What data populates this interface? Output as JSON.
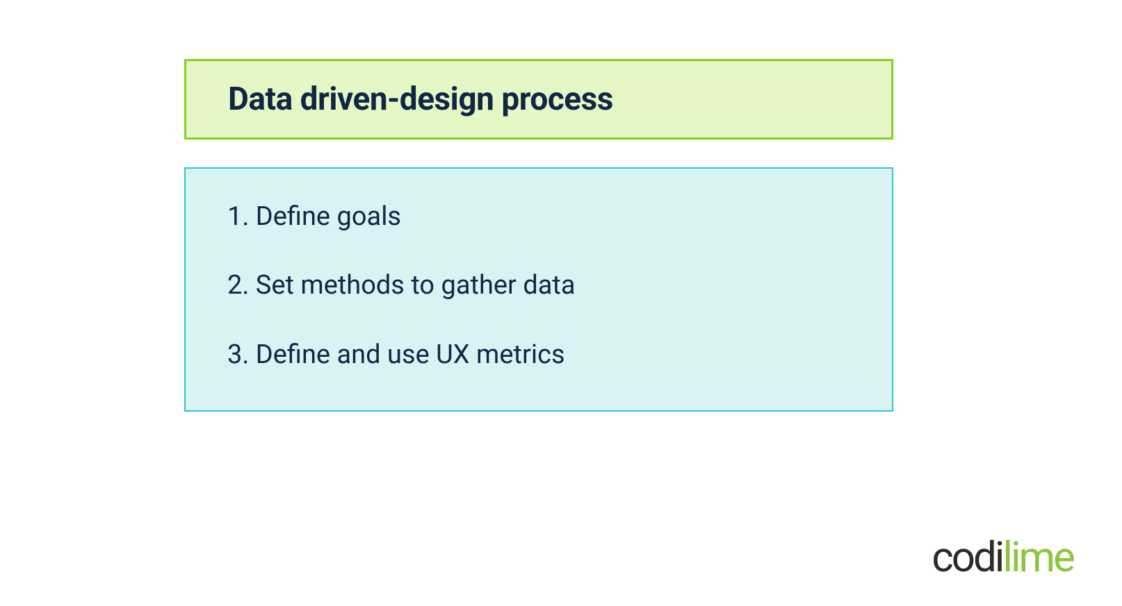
{
  "title": "Data driven-design process",
  "steps": [
    "1. Define goals",
    "2. Set methods to gather data",
    "3. Define and use UX metrics"
  ],
  "logo": {
    "part1": "codi",
    "part2": "lime"
  },
  "colors": {
    "titleBg": "#e5f7c5",
    "titleBorder": "#7ed321",
    "listBg": "#d9f2f3",
    "listBorder": "#2ec4d4",
    "textDark": "#0f2744",
    "logoGreen": "#8cc63f",
    "logoDark": "#2a2a2a"
  }
}
